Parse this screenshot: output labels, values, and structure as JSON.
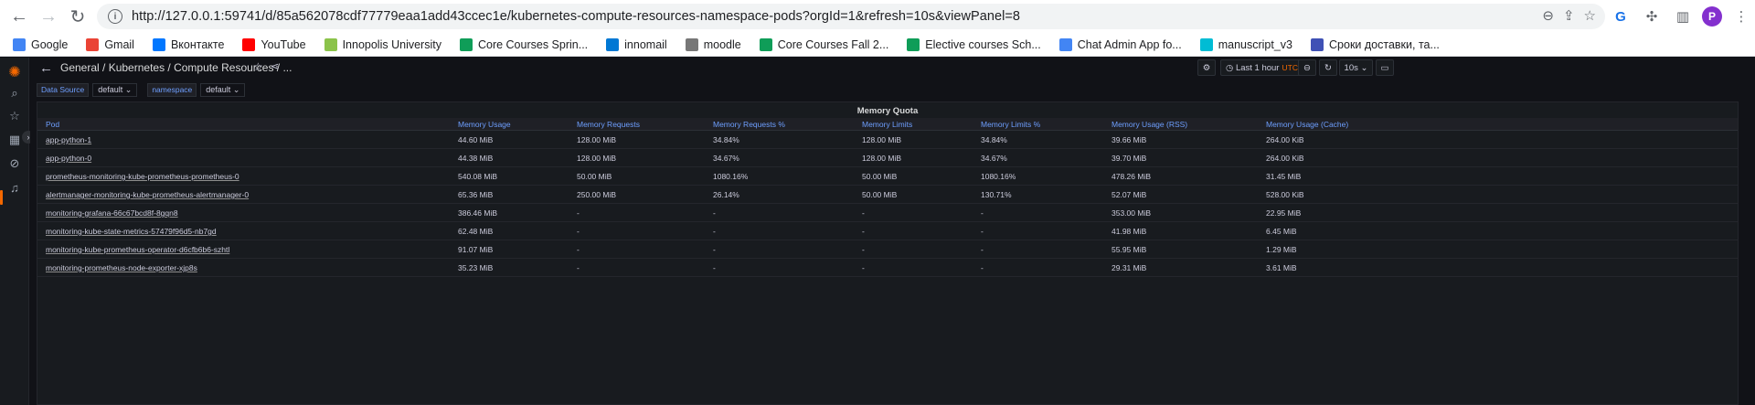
{
  "browser": {
    "url": "http://127.0.0.1:59741/d/85a562078cdf77779eaa1add43ccec1e/kubernetes-compute-resources-namespace-pods?orgId=1&refresh=10s&viewPanel=8",
    "profile_initial": "P",
    "bookmarks": [
      {
        "label": "Google",
        "icon": "google-icon",
        "color": "#4285f4"
      },
      {
        "label": "Gmail",
        "icon": "gmail-icon",
        "color": "#ea4335"
      },
      {
        "label": "Вконтакте",
        "icon": "vk-icon",
        "color": "#0077ff"
      },
      {
        "label": "YouTube",
        "icon": "youtube-icon",
        "color": "#ff0000"
      },
      {
        "label": "Innopolis University",
        "icon": "innopolis-icon",
        "color": "#8bc34a"
      },
      {
        "label": "Core Courses Sprin...",
        "icon": "sheets-icon",
        "color": "#0f9d58"
      },
      {
        "label": "innomail",
        "icon": "outlook-icon",
        "color": "#0078d4"
      },
      {
        "label": "moodle",
        "icon": "moodle-icon",
        "color": "#777777"
      },
      {
        "label": "Core Courses Fall 2...",
        "icon": "sheets-icon",
        "color": "#0f9d58"
      },
      {
        "label": "Elective courses Sch...",
        "icon": "sheets-icon",
        "color": "#0f9d58"
      },
      {
        "label": "Chat Admin App fo...",
        "icon": "docs-icon",
        "color": "#4285f4"
      },
      {
        "label": "manuscript_v3",
        "icon": "manuscript-icon",
        "color": "#00bcd4"
      },
      {
        "label": "Сроки доставки, та...",
        "icon": "delivery-icon",
        "color": "#3f51b5"
      }
    ]
  },
  "grafana": {
    "breadcrumb": "General  / Kubernetes / Compute Resources / ...",
    "time_range": "Last 1 hour",
    "timezone": "UTC",
    "refresh_interval": "10s",
    "variables": [
      {
        "label": "Data Source",
        "value": "default"
      },
      {
        "label": "namespace",
        "value": "default"
      }
    ],
    "panel_title": "Memory Quota",
    "columns": [
      "Pod",
      "Memory Usage",
      "Memory Requests",
      "Memory Requests %",
      "Memory Limits",
      "Memory Limits %",
      "Memory Usage (RSS)",
      "Memory Usage (Cache)"
    ],
    "rows": [
      [
        "app-python-1",
        "44.60 MiB",
        "128.00 MiB",
        "34.84%",
        "128.00 MiB",
        "34.84%",
        "39.66 MiB",
        "264.00 KiB"
      ],
      [
        "app-python-0",
        "44.38 MiB",
        "128.00 MiB",
        "34.67%",
        "128.00 MiB",
        "34.67%",
        "39.70 MiB",
        "264.00 KiB"
      ],
      [
        "prometheus-monitoring-kube-prometheus-prometheus-0",
        "540.08 MiB",
        "50.00 MiB",
        "1080.16%",
        "50.00 MiB",
        "1080.16%",
        "478.26 MiB",
        "31.45 MiB"
      ],
      [
        "alertmanager-monitoring-kube-prometheus-alertmanager-0",
        "65.36 MiB",
        "250.00 MiB",
        "26.14%",
        "50.00 MiB",
        "130.71%",
        "52.07 MiB",
        "528.00 KiB"
      ],
      [
        "monitoring-grafana-66c67bcd8f-8gqn8",
        "386.46 MiB",
        "-",
        "-",
        "-",
        "-",
        "353.00 MiB",
        "22.95 MiB"
      ],
      [
        "monitoring-kube-state-metrics-57479f96d5-nb7gd",
        "62.48 MiB",
        "-",
        "-",
        "-",
        "-",
        "41.98 MiB",
        "6.45 MiB"
      ],
      [
        "monitoring-kube-prometheus-operator-d6cfb6b6-szhtl",
        "91.07 MiB",
        "-",
        "-",
        "-",
        "-",
        "55.95 MiB",
        "1.29 MiB"
      ],
      [
        "monitoring-prometheus-node-exporter-xjp8s",
        "35.23 MiB",
        "-",
        "-",
        "-",
        "-",
        "29.31 MiB",
        "3.61 MiB"
      ]
    ]
  }
}
